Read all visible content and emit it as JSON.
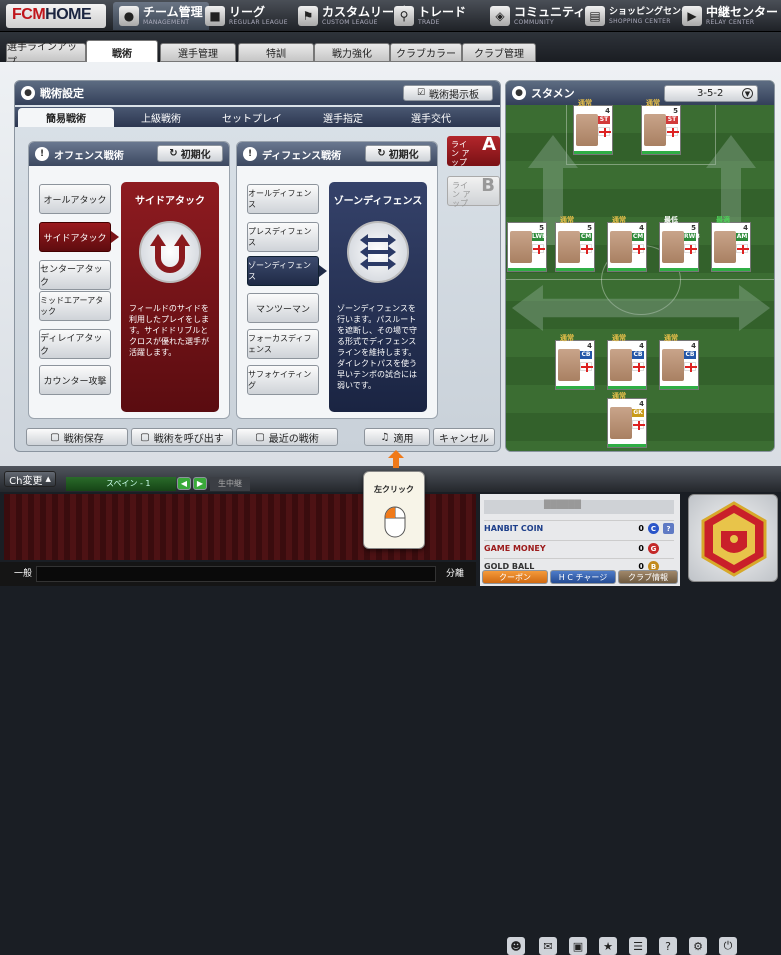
{
  "nav": {
    "logo_main": "FCM",
    "logo_sub": "HOME",
    "items": [
      {
        "jp": "チーム管理",
        "en": "MANAGEMENT",
        "icon": "person-icon"
      },
      {
        "jp": "リーグ",
        "en": "REGULAR LEAGUE",
        "icon": "league-icon"
      },
      {
        "jp": "カスタムリーグ",
        "en": "CUSTOM LEAGUE",
        "icon": "custom-league-icon"
      },
      {
        "jp": "トレード",
        "en": "TRADE",
        "icon": "search-icon"
      },
      {
        "jp": "コミュニティ",
        "en": "COMMUNITY",
        "icon": "community-icon"
      },
      {
        "jp": "ショッピングセンター",
        "en": "SHOPPING CENTER",
        "icon": "gift-icon"
      },
      {
        "jp": "中継センター",
        "en": "RELAY CENTER",
        "icon": "relay-icon"
      }
    ]
  },
  "subtabs": [
    "選手ラインアップ",
    "戦術",
    "選手管理",
    "特訓",
    "戦力強化",
    "クラブカラー",
    "クラブ管理"
  ],
  "tactics": {
    "title": "戦術設定",
    "board_button": "戦術掲示板",
    "tabs": [
      "簡易戦術",
      "上級戦術",
      "セットプレイ",
      "選手指定",
      "選手交代"
    ],
    "offense": {
      "title": "オフェンス戦術",
      "reset": "初期化",
      "options": [
        "オールアタック",
        "サイドアタック",
        "センターアタック",
        "ミッドエアーアタック",
        "ディレイアタック",
        "カウンター攻撃"
      ],
      "selected_title": "サイドアタック",
      "selected_desc": "フィールドのサイドを利用したプレイをします。サイドドリブルとクロスが優れた選手が活躍します。"
    },
    "defense": {
      "title": "ディフェンス戦術",
      "reset": "初期化",
      "options": [
        "オールディフェンス",
        "プレスディフェンス",
        "ゾーンディフェンス",
        "マンツーマン",
        "フォーカスディフェンス",
        "サフォケイティング"
      ],
      "selected_title": "ゾーンディフェンス",
      "selected_desc": "ゾーンディフェンスを行います。パスルートを遮断し、その場で守る形式でディフェンスラインを維持します。ダイレクトパスを使う早いテンポの試合には弱いです。"
    },
    "lineup_a": {
      "text": "ライン アップ",
      "letter": "A"
    },
    "lineup_b": {
      "text": "ライン アップ",
      "letter": "B"
    },
    "bottom_buttons": [
      "戦術保存",
      "戦術を呼び出す",
      "最近の戦術",
      "適用",
      "キャンセル"
    ]
  },
  "starting": {
    "title": "スタメン",
    "formation": "3-5-2",
    "players": [
      {
        "pos": "ST",
        "num": "4",
        "tag": "通常",
        "pos_color": "#d23b3b"
      },
      {
        "pos": "ST",
        "num": "5",
        "tag": "通常",
        "pos_color": "#d23b3b"
      },
      {
        "pos": "LWB",
        "num": "5",
        "tag": "",
        "pos_color": "#2e8b3a"
      },
      {
        "pos": "CM",
        "num": "5",
        "tag": "通常",
        "pos_color": "#2e8b3a"
      },
      {
        "pos": "CM",
        "num": "4",
        "tag": "通常",
        "pos_color": "#2e8b3a"
      },
      {
        "pos": "RWB",
        "num": "5",
        "tag": "最低",
        "pos_color": "#2e8b3a"
      },
      {
        "pos": "AM",
        "num": "4",
        "tag": "最適",
        "pos_color": "#2e8b3a"
      },
      {
        "pos": "CB",
        "num": "4",
        "tag": "通常",
        "pos_color": "#2456a8"
      },
      {
        "pos": "CB",
        "num": "4",
        "tag": "通常",
        "pos_color": "#2456a8"
      },
      {
        "pos": "CB",
        "num": "4",
        "tag": "通常",
        "pos_color": "#2456a8"
      },
      {
        "pos": "GK",
        "num": "4",
        "tag": "通常",
        "pos_color": "#c99a1a"
      }
    ]
  },
  "chat": {
    "channel_button": "Ch変更",
    "channel_name": "スペイン - 1",
    "live": "生中継",
    "mode": "一般",
    "send": "分離",
    "tooltip": "左クリック"
  },
  "account": {
    "rows": [
      {
        "label": "HANBIT COIN",
        "value": "0",
        "coin": "C",
        "color": "#1c3e8a",
        "coin_color": "#2a55c9"
      },
      {
        "label": "GAME MONEY",
        "value": "0",
        "coin": "G",
        "color": "#9c1a1a",
        "coin_color": "#c42828"
      },
      {
        "label": "GOLD BALL",
        "value": "0",
        "coin": "B",
        "color": "#333",
        "coin_color": "#c28a1c"
      }
    ],
    "buttons": [
      "クーポン",
      "H C チャージ",
      "クラブ情報"
    ]
  }
}
